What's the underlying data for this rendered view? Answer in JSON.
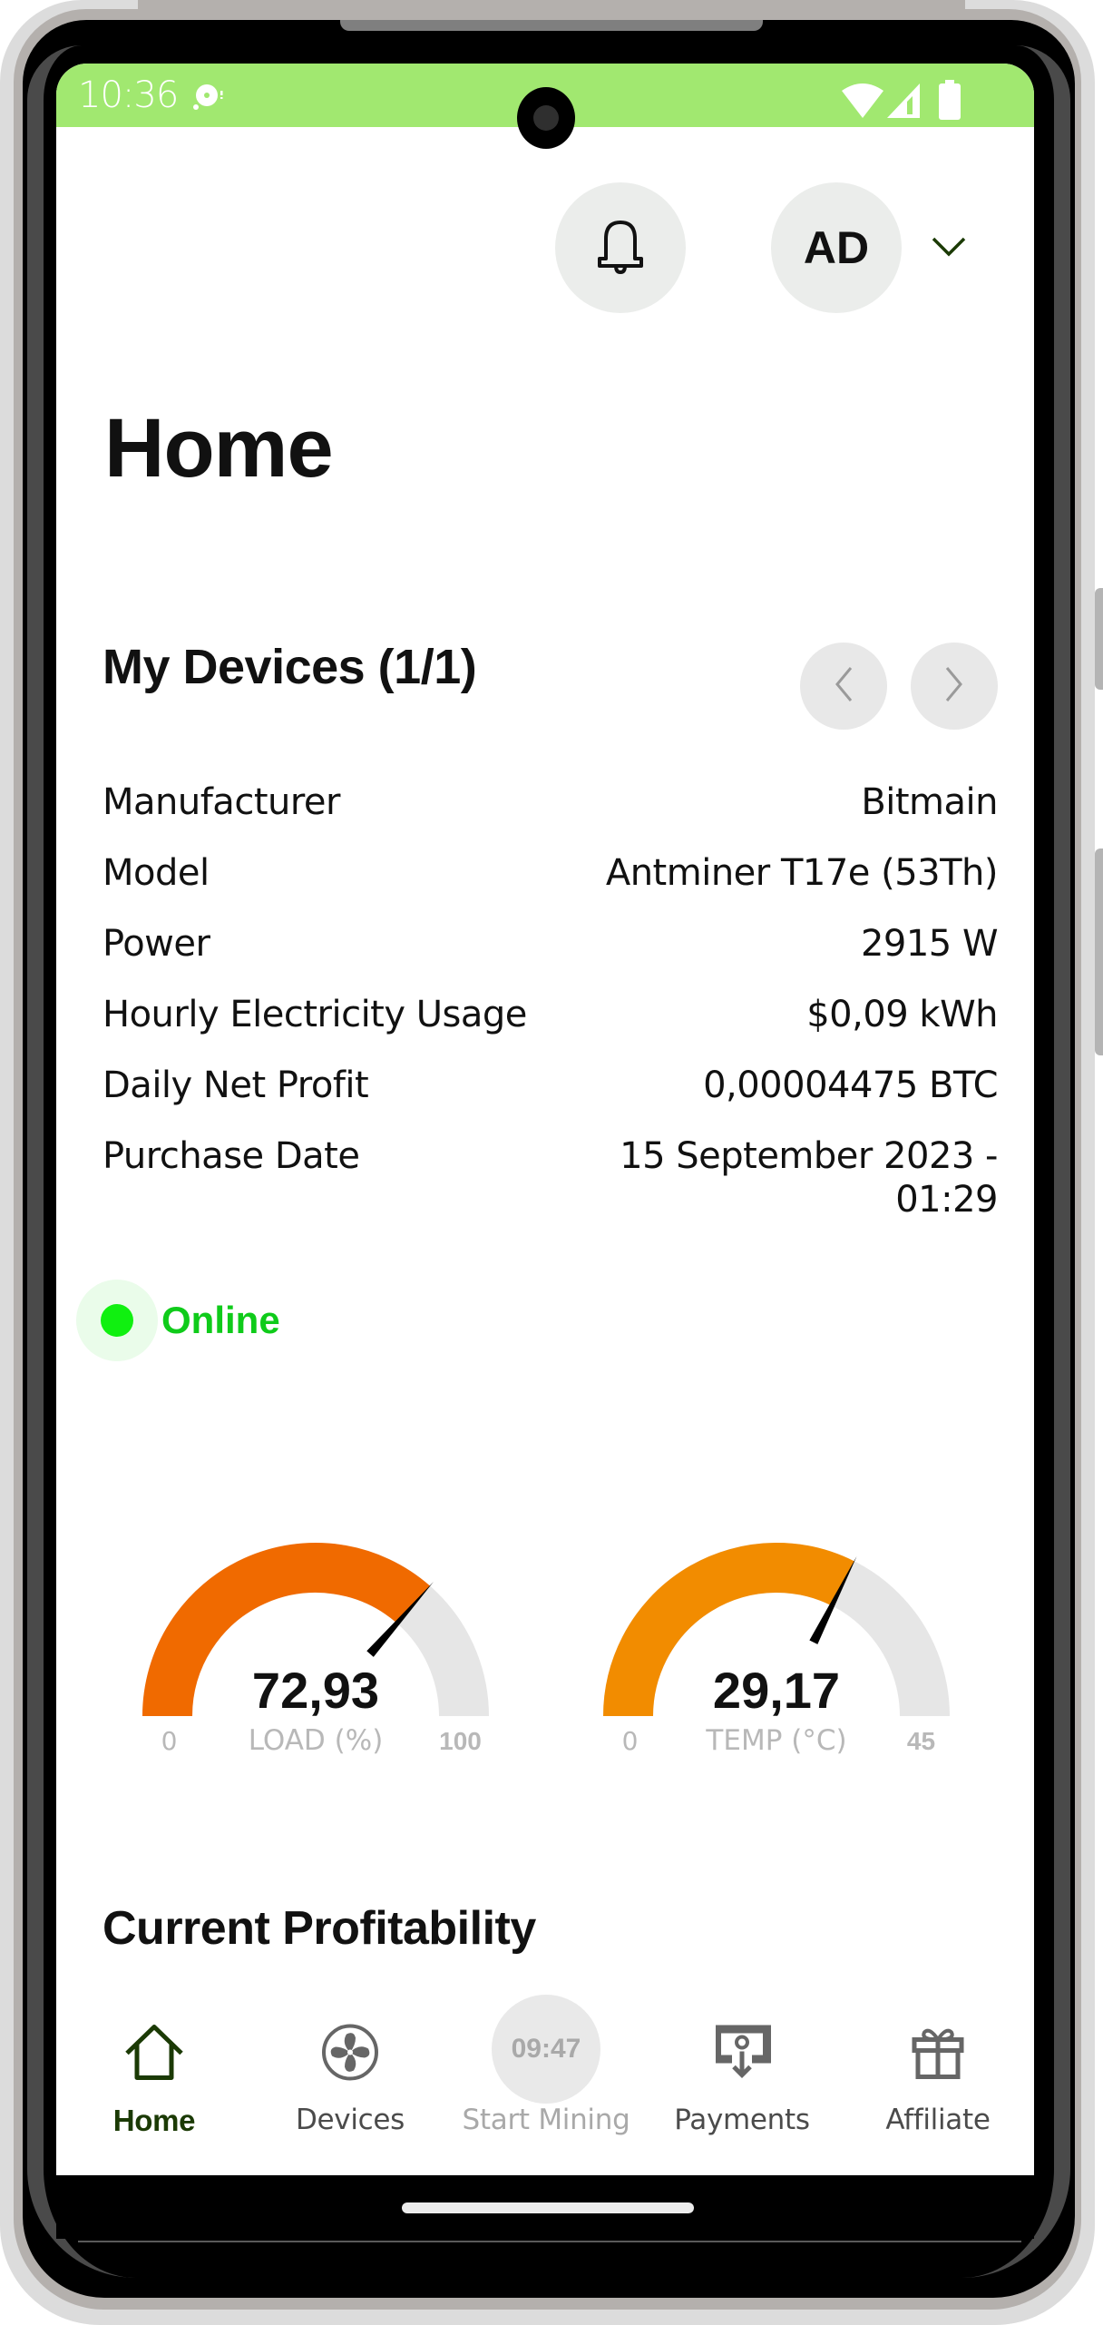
{
  "status_bar": {
    "time": "10:36",
    "notification_icon": "sync-disc-icon",
    "icons": [
      "wifi-icon",
      "cellular-signal-icon",
      "battery-icon"
    ],
    "background_color": "#a1e870"
  },
  "header": {
    "notification_icon": "bell-icon",
    "avatar_initials": "AD",
    "account_menu_icon": "chevron-down-icon"
  },
  "page": {
    "title": "Home"
  },
  "devices": {
    "title": "My Devices (1/1)",
    "prev_icon": "chevron-left-icon",
    "next_icon": "chevron-right-icon",
    "details": [
      {
        "label": "Manufacturer",
        "value": "Bitmain"
      },
      {
        "label": "Model",
        "value": "Antminer T17e (53Th)"
      },
      {
        "label": "Power",
        "value": "2915 W"
      },
      {
        "label": "Hourly Electricity Usage",
        "value": "$0,09 kWh"
      },
      {
        "label": "Daily Net Profit",
        "value": "0,00004475 BTC"
      },
      {
        "label": "Purchase Date",
        "value": "15 September 2023 - 01:29"
      }
    ],
    "status": {
      "label": "Online",
      "color": "#0fcb1a"
    },
    "gauges": [
      {
        "name": "load",
        "value": 72.93,
        "value_label": "72,93",
        "label": "LOAD (%)",
        "min": 0,
        "max": 100,
        "min_label": "0",
        "max_label": "100",
        "color": "#f06a00"
      },
      {
        "name": "temp",
        "value": 29.17,
        "value_label": "29,17",
        "label": "TEMP (°C)",
        "min": 0,
        "max": 45,
        "min_label": "0",
        "max_label": "45",
        "color": "#f28c00"
      }
    ]
  },
  "profitability": {
    "title": "Current Profitability"
  },
  "bottom_nav": {
    "items": [
      {
        "label": "Home",
        "icon": "home-icon",
        "state": "active"
      },
      {
        "label": "Devices",
        "icon": "fan-icon",
        "state": "normal"
      },
      {
        "label": "Start Mining",
        "icon": "timer-icon",
        "timer": "09:47",
        "state": "disabled"
      },
      {
        "label": "Payments",
        "icon": "money-withdraw-icon",
        "state": "normal"
      },
      {
        "label": "Affiliate",
        "icon": "gift-icon",
        "state": "normal"
      }
    ]
  }
}
